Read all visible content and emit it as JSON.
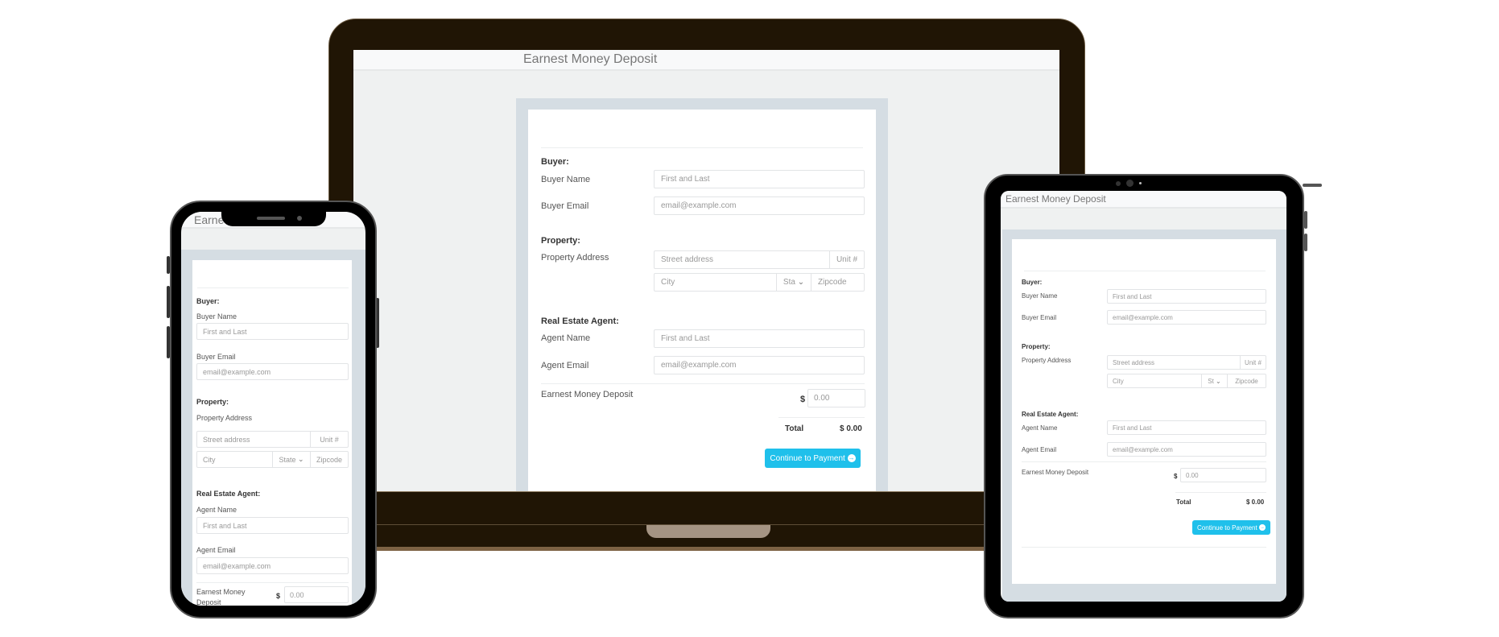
{
  "app": {
    "title": "Earnest Money Deposit",
    "title_truncated_phone": "Earne"
  },
  "form": {
    "buyer_section": "Buyer:",
    "buyer_name_label": "Buyer Name",
    "buyer_name_placeholder": "First and Last",
    "buyer_email_label": "Buyer Email",
    "buyer_email_placeholder": "email@example.com",
    "property_section": "Property:",
    "property_address_label": "Property Address",
    "street_placeholder": "Street address",
    "unit_placeholder": "Unit #",
    "city_placeholder": "City",
    "state_select_value": "State",
    "state_select_value_truncated": "Sta",
    "state_select_value_tablet": "St",
    "zipcode_placeholder": "Zipcode",
    "agent_section": "Real Estate Agent:",
    "agent_name_label": "Agent Name",
    "agent_name_placeholder": "First and Last",
    "agent_email_label": "Agent Email",
    "agent_email_placeholder": "email@example.com",
    "deposit_label": "Earnest Money Deposit",
    "deposit_label_line1": "Earnest Money",
    "deposit_label_line2": "Deposit",
    "currency_symbol": "$",
    "deposit_placeholder": "0.00",
    "total_label": "Total",
    "total_value": "$ 0.00",
    "continue_button": "Continue to Payment",
    "continue_icon": "circle-arrow-right-icon"
  },
  "colors": {
    "accent": "#1fc0eb",
    "laptop_body": "#201505",
    "panel": "#d5dde3",
    "page_bg": "#eff1f1"
  }
}
